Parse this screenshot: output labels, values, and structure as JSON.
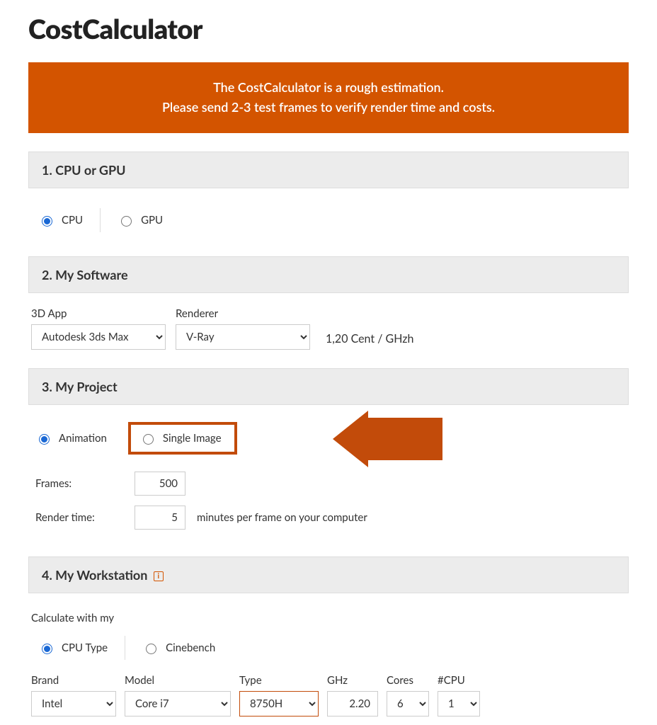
{
  "page_title": "CostCalculator",
  "banner": {
    "line1": "The CostCalculator is a rough estimation.",
    "line2": "Please send 2-3 test frames to verify render time and costs."
  },
  "section1": {
    "heading": "1. CPU or GPU",
    "cpu_label": "CPU",
    "gpu_label": "GPU"
  },
  "section2": {
    "heading": "2. My Software",
    "app_label": "3D App",
    "app_value": "Autodesk 3ds Max",
    "renderer_label": "Renderer",
    "renderer_value": "V-Ray",
    "price_text": "1,20 Cent / GHzh"
  },
  "section3": {
    "heading": "3. My Project",
    "animation_label": "Animation",
    "single_image_label": "Single Image",
    "frames_label": "Frames:",
    "frames_value": "500",
    "render_time_label": "Render time:",
    "render_time_value": "5",
    "render_time_suffix": "minutes per frame on your computer"
  },
  "section4": {
    "heading": "4. My Workstation",
    "calc_with_label": "Calculate with my",
    "cpu_type_label": "CPU Type",
    "cinebench_label": "Cinebench",
    "brand_label": "Brand",
    "brand_value": "Intel",
    "model_label": "Model",
    "model_value": "Core i7",
    "type_label": "Type",
    "type_value": "8750H",
    "ghz_label": "GHz",
    "ghz_value": "2.20",
    "cores_label": "Cores",
    "cores_value": "6",
    "numcpu_label": "#CPU",
    "numcpu_value": "1"
  }
}
